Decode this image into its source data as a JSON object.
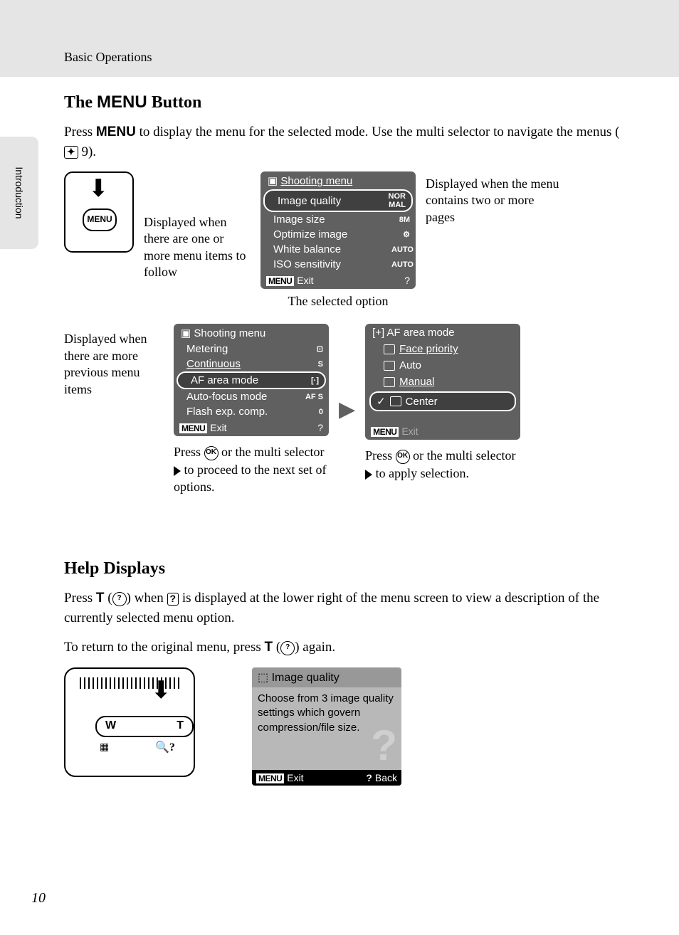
{
  "page": {
    "breadcrumb": "Basic Operations",
    "sidebar_label": "Introduction",
    "page_number": "10"
  },
  "section1": {
    "heading_pre": "The ",
    "heading_menu": "MENU",
    "heading_post": " Button",
    "body_pre": "Press ",
    "body_menu": "MENU",
    "body_post": " to display the menu for the selected mode. Use the multi selector to navigate the menus (",
    "body_ref": " 9)."
  },
  "annot": {
    "scroll": "Displayed when the menu contains two or more pages",
    "follow": "Displayed when there are one or more menu items to follow",
    "prev": "Displayed when there are more previous menu items",
    "selected": "The selected option",
    "press_next": "Press         or the multi selector       to proceed to the next set of options.",
    "press_next_1": "Press ",
    "press_next_2": " or the multi selector ",
    "press_next_3": " to proceed to the next set of options.",
    "press_apply_1": "Press ",
    "press_apply_2": " or the multi selector ",
    "press_apply_3": " to apply selection."
  },
  "screen1": {
    "title": "Shooting menu",
    "items": [
      "Image quality",
      "Image size",
      "Optimize image",
      "White balance",
      "ISO sensitivity"
    ],
    "values": [
      "NOR MAL",
      "8M",
      "⚙",
      "AUTO",
      "AUTO"
    ],
    "exit": "Exit",
    "menu_label": "MENU"
  },
  "screen2": {
    "title": "Shooting menu",
    "items": [
      "Metering",
      "Continuous",
      "AF area mode",
      "Auto-focus mode",
      "Flash exp. comp."
    ],
    "values": [
      "⊡",
      "S",
      "[·]",
      "AF S",
      "0"
    ],
    "exit": "Exit",
    "menu_label": "MENU"
  },
  "screen3": {
    "title": "AF area mode",
    "options": [
      "Face priority",
      "Auto",
      "Manual",
      "Center"
    ],
    "exit": "Exit",
    "menu_label": "MENU"
  },
  "camera": {
    "button_label": "MENU",
    "zoom_w": "W",
    "zoom_t": "T"
  },
  "section2": {
    "heading": "Help Displays",
    "body1_pre": "Press ",
    "body1_t": "T",
    "body1_mid1": " (",
    "body1_mid2": ") when ",
    "body1_mid3": " is displayed at the lower right of the menu screen to view a description of the currently selected menu option.",
    "body2_pre": "To return to the original menu, press ",
    "body2_t": "T",
    "body2_mid": " (",
    "body2_post": ") again."
  },
  "help": {
    "title": "Image quality",
    "body": "Choose from 3 image quality settings which govern compression/file size.",
    "exit": "Exit",
    "back": "Back",
    "menu_label": "MENU"
  }
}
